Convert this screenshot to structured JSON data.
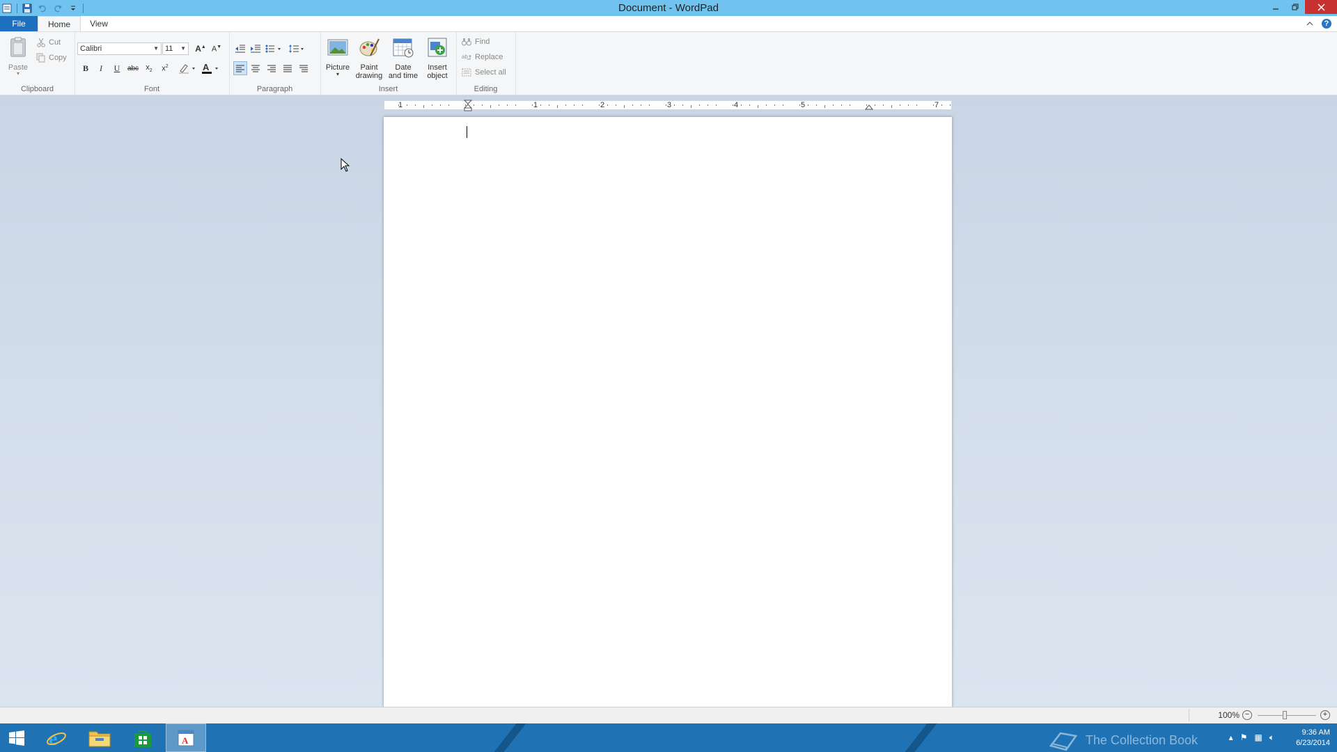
{
  "window": {
    "title": "Document - WordPad"
  },
  "tabs": {
    "file": "File",
    "home": "Home",
    "view": "View"
  },
  "clipboard": {
    "group": "Clipboard",
    "paste": "Paste",
    "cut": "Cut",
    "copy": "Copy"
  },
  "font": {
    "group": "Font",
    "family": "Calibri",
    "size": "11"
  },
  "paragraph": {
    "group": "Paragraph"
  },
  "insert": {
    "group": "Insert",
    "picture": "Picture",
    "paint_drawing": "Paint drawing",
    "date_time": "Date and time",
    "insert_object": "Insert object"
  },
  "editing": {
    "group": "Editing",
    "find": "Find",
    "replace": "Replace",
    "select_all": "Select all"
  },
  "ruler": {
    "numbers": [
      "1",
      "1",
      "2",
      "3",
      "4",
      "5",
      "7"
    ]
  },
  "status": {
    "zoom": "100%"
  },
  "taskbar": {
    "time": "9:36 AM",
    "date": "6/23/2014",
    "watermark": "The Collection Book"
  },
  "colors": {
    "titlebar": "#6fc3ee",
    "file_tab": "#1f6fbf",
    "taskbar": "#1f73b4",
    "close": "#c7312f"
  }
}
